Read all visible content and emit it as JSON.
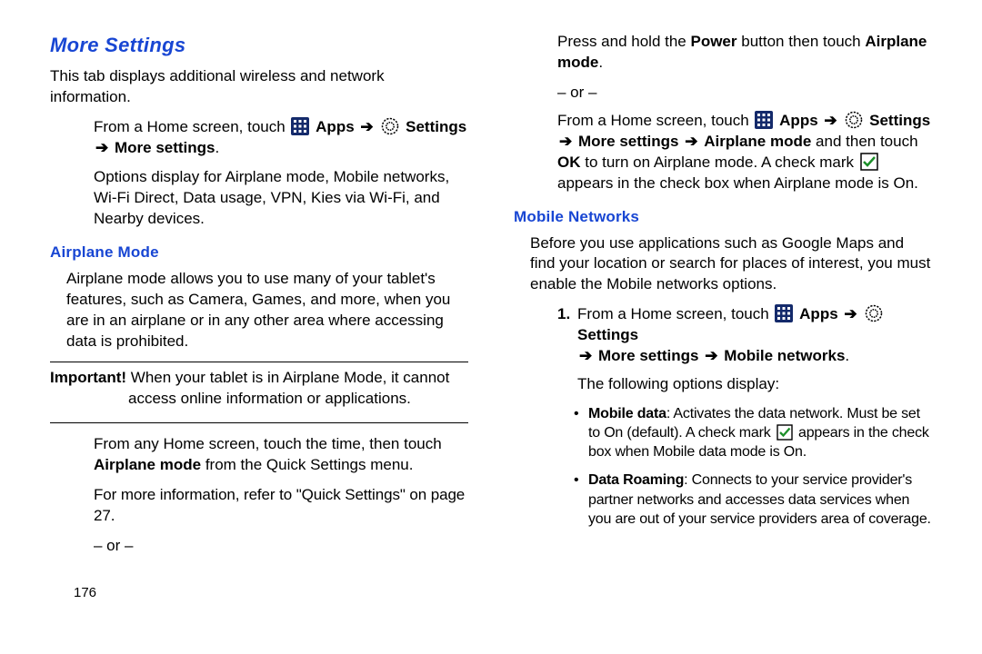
{
  "col1": {
    "h1": "More Settings",
    "p1": "This tab displays additional wireless and network information.",
    "step_from_home": "From a Home screen, touch ",
    "apps_label": "Apps",
    "settings_label": "Settings",
    "more_settings": "More settings",
    "options_text": "Options display for Airplane mode, Mobile networks, Wi‑Fi Direct, Data usage, VPN, Kies via Wi‑Fi, and Nearby devices.",
    "h_airplane": "Airplane Mode",
    "airplane_para": "Airplane mode allows you to use many of your tablet's features, such as Camera, Games, and more, when you are in an airplane or in any other area where accessing data is prohibited.",
    "important_label": "Important!",
    "important_text_1": " When your tablet is in Airplane Mode, it cannot",
    "important_text_2": "access online information or applications.",
    "step_from_any_1": "From any Home screen, touch the time, then touch ",
    "airplane_mode_bold": "Airplane mode",
    "step_from_any_2": " from the Quick Settings menu.",
    "refer_text_1": "For more information, refer to ",
    "quick_settings": "\"Quick Settings\"",
    "refer_text_2": " on page 27.",
    "or": "– or –",
    "pagenum": "176"
  },
  "col2": {
    "press_hold_1": "Press and hold the ",
    "power": "Power",
    "press_hold_2": " button then touch ",
    "airplane_mode_bold": "Airplane mode",
    "period": ".",
    "or": "– or –",
    "from_home": "From a Home screen, touch ",
    "apps_label": "Apps",
    "settings_label": "Settings",
    "more_settings": "More settings",
    "airplane_bold2": "Airplane mode",
    "and_touch_ok": " and then touch ",
    "ok": "OK",
    "to_turn_on": " to turn on Airplane mode. A check mark ",
    "appears_text": " appears in the check box when Airplane mode is On.",
    "h_mobile": "Mobile Networks",
    "mobile_intro": "Before you use applications such as Google Maps and find your location or search for places of interest, you must enable the Mobile networks options.",
    "num1": "1.",
    "from_home2": "From a Home screen, touch ",
    "mobile_networks": "Mobile networks",
    "following_opts": "The following options display:",
    "bullet1_bold": "Mobile data",
    "bullet1_text_a": ": Activates the data network. Must be set to On (default). A check mark ",
    "bullet1_text_b": " appears in the check box when Mobile data mode is On.",
    "bullet2_bold": "Data Roaming",
    "bullet2_text": ": Connects to your service provider's partner networks and accesses data services when you are out of your service providers area of coverage."
  }
}
